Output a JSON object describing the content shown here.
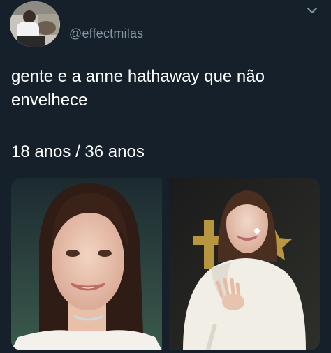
{
  "tweet": {
    "handle": "@effectmilas",
    "text_line1": "gente e a anne hathaway que não envelhece",
    "text_line2": "18 anos / 36 anos"
  },
  "icons": {
    "menu": "chevron-down-icon",
    "avatar": "user-avatar"
  },
  "colors": {
    "background": "#15202b",
    "handle": "#8899a6",
    "text": "#ffffff"
  }
}
